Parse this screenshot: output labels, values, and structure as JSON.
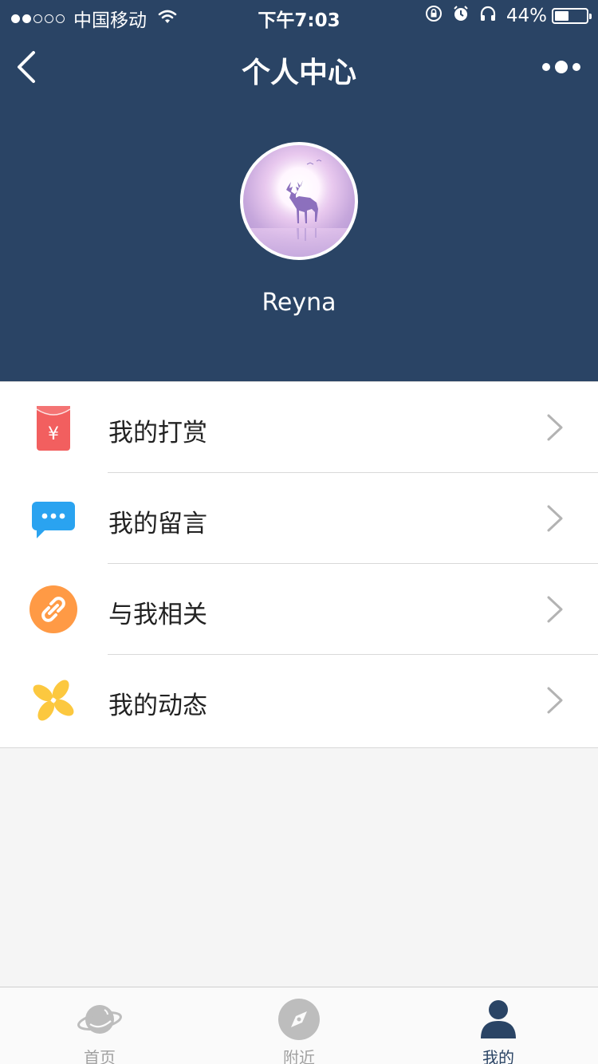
{
  "statusbar": {
    "carrier": "中国移动",
    "time": "下午7:03",
    "battery": "44%",
    "battery_level": 0.44,
    "signal_dots_filled": 2,
    "signal_dots_total": 5
  },
  "navbar": {
    "title": "个人中心",
    "back_icon": "chevron-left-icon",
    "more_icon": "more-dots-icon"
  },
  "profile": {
    "username": "Reyna",
    "avatar": "deer-moon-avatar"
  },
  "menu": {
    "items": [
      {
        "label": "我的打赏",
        "icon": "red-envelope-icon",
        "color": "#f25f5f"
      },
      {
        "label": "我的留言",
        "icon": "message-bubble-icon",
        "color": "#2aa3f0"
      },
      {
        "label": "与我相关",
        "icon": "link-icon",
        "color": "#ff9a45"
      },
      {
        "label": "我的动态",
        "icon": "pinwheel-icon",
        "color": "#fcc83f"
      }
    ]
  },
  "tabbar": {
    "tabs": [
      {
        "label": "首页",
        "icon": "planet-icon",
        "active": false
      },
      {
        "label": "附近",
        "icon": "compass-icon",
        "active": false
      },
      {
        "label": "我的",
        "icon": "user-icon",
        "active": true
      }
    ]
  },
  "colors": {
    "header_bg": "#2a4465",
    "page_bg": "#f5f5f5",
    "tab_active": "#2a4465",
    "tab_inactive": "#a0a0a0"
  }
}
